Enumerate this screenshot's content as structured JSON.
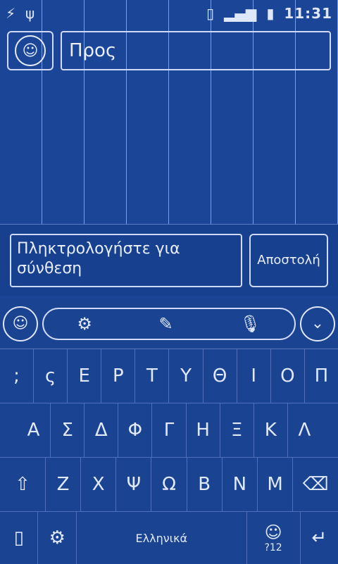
{
  "status": {
    "time": "11:31",
    "left_icons": [
      "usb-icon",
      "lightning-icon"
    ],
    "right_icons": [
      "sim-icon",
      "signal-icon",
      "battery-icon"
    ]
  },
  "recipient": {
    "placeholder": "Προς"
  },
  "compose": {
    "placeholder": "Πληκτρολογήστε για σύνθεση",
    "send_label": "Αποστολή"
  },
  "keyboard": {
    "tools": [
      "settings-icon",
      "pen-icon",
      "microphone-icon"
    ],
    "row1": [
      ";",
      "ς",
      "Ε",
      "Ρ",
      "Τ",
      "Υ",
      "Θ",
      "Ι",
      "Ο",
      "Π"
    ],
    "row2": [
      "Α",
      "Σ",
      "Δ",
      "Φ",
      "Γ",
      "Η",
      "Ξ",
      "Κ",
      "Λ"
    ],
    "row3": [
      "⇧",
      "Ζ",
      "Χ",
      "Ψ",
      "Ω",
      "Β",
      "Ν",
      "Μ",
      "⌫"
    ],
    "space_label": "Ελληνικά",
    "sym_label": "?12",
    "enter_label": "↵"
  }
}
